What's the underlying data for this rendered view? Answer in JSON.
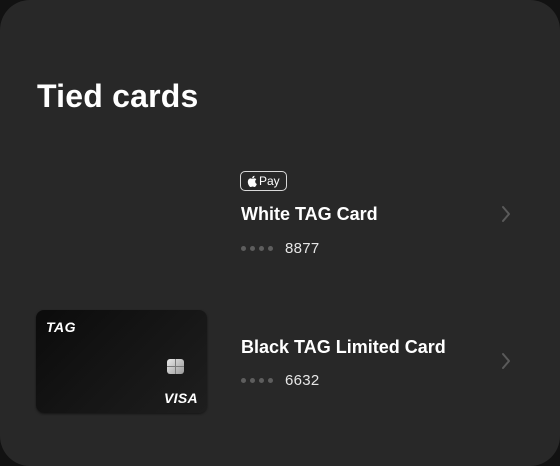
{
  "page": {
    "title": "Tied cards"
  },
  "cards": [
    {
      "badge": {
        "icon": "apple-icon",
        "label": "Pay"
      },
      "name": "White TAG Card",
      "last4": "8877",
      "chevron": "chevron-right-icon"
    },
    {
      "art": {
        "logo": "TAG",
        "brand": "VISA"
      },
      "name": "Black TAG Limited Card",
      "last4": "6632",
      "chevron": "chevron-right-icon"
    }
  ],
  "colors": {
    "panel_bg": "#282828",
    "text_primary": "#ffffff",
    "mask_dot": "#5e5e5e",
    "chevron": "#5a5a5a"
  }
}
